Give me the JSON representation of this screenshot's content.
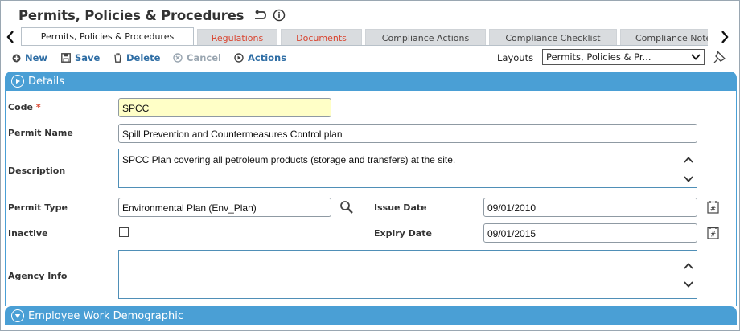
{
  "page": {
    "title": "Permits, Policies & Procedures"
  },
  "tabs": [
    {
      "label": "Permits, Policies & Procedures",
      "state": "active"
    },
    {
      "label": "Regulations",
      "state": "highlight"
    },
    {
      "label": "Documents",
      "state": "highlight"
    },
    {
      "label": "Compliance Actions",
      "state": "normal"
    },
    {
      "label": "Compliance Checklist",
      "state": "normal"
    },
    {
      "label": "Compliance Notes",
      "state": "normal"
    }
  ],
  "toolbar": {
    "new_label": "New",
    "save_label": "Save",
    "delete_label": "Delete",
    "cancel_label": "Cancel",
    "actions_label": "Actions",
    "layouts_label": "Layouts",
    "layouts_value": "Permits, Policies & Pr..."
  },
  "details": {
    "header": "Details",
    "code": {
      "label": "Code",
      "required_mark": "*",
      "value": "SPCC"
    },
    "permit_name": {
      "label": "Permit Name",
      "value": "Spill Prevention and Countermeasures Control plan"
    },
    "description": {
      "label": "Description",
      "value": "SPCC Plan covering all petroleum products (storage and transfers) at the site."
    },
    "permit_type": {
      "label": "Permit Type",
      "value": "Environmental Plan (Env_Plan)"
    },
    "issue_date": {
      "label": "Issue Date",
      "value": "09/01/2010"
    },
    "inactive": {
      "label": "Inactive",
      "checked": false
    },
    "expiry_date": {
      "label": "Expiry Date",
      "value": "09/01/2015"
    },
    "agency_info": {
      "label": "Agency Info",
      "value": ""
    }
  },
  "sections": {
    "employee_header": "Employee Work Demographic"
  },
  "colors": {
    "section_blue": "#4a9fd5",
    "link_blue": "#2f6ea5",
    "tab_red": "#d9442f",
    "code_field_bg": "#ffffc7"
  },
  "icons": [
    "back-arrow-icon",
    "info-icon",
    "chevron-left-icon",
    "chevron-right-icon",
    "plus-icon",
    "save-icon",
    "trash-icon",
    "cancel-icon",
    "actions-icon",
    "dropdown-icon",
    "pin-icon",
    "expand-icon",
    "search-icon",
    "calendar-icon",
    "scroll-up-icon",
    "scroll-down-icon"
  ]
}
